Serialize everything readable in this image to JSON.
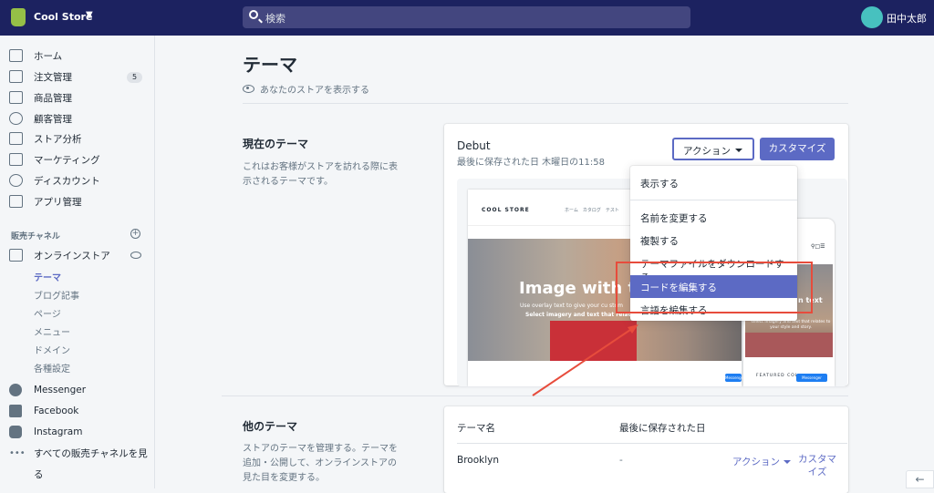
{
  "topbar": {
    "store_name": "Cool Store",
    "search_placeholder": "検索",
    "user_name": "田中太郎"
  },
  "sidebar": {
    "items": [
      {
        "label": "ホーム",
        "icon": "home-icon"
      },
      {
        "label": "注文管理",
        "icon": "orders-icon",
        "badge": "5"
      },
      {
        "label": "商品管理",
        "icon": "tag-icon"
      },
      {
        "label": "顧客管理",
        "icon": "person-icon"
      },
      {
        "label": "ストア分析",
        "icon": "bar-chart-icon"
      },
      {
        "label": "マーケティング",
        "icon": "megaphone-icon"
      },
      {
        "label": "ディスカウント",
        "icon": "discount-icon"
      },
      {
        "label": "アプリ管理",
        "icon": "apps-icon"
      }
    ],
    "channels_header": "販売チャネル",
    "online_store": "オンラインストア",
    "sub_items": [
      "テーマ",
      "ブログ記事",
      "ページ",
      "メニュー",
      "ドメイン",
      "各種設定"
    ],
    "channels": [
      "Messenger",
      "Facebook",
      "Instagram",
      "すべての販売チャネルを見",
      "る"
    ]
  },
  "main": {
    "title": "テーマ",
    "view_store": "あなたのストアを表示する",
    "current_theme_title": "現在のテーマ",
    "current_theme_desc1": "これはお客様がストアを訪れる際に表",
    "current_theme_desc2": "示されるテーマです。",
    "theme_name": "Debut",
    "last_saved": "最後に保存された日 木曜日の11:58",
    "action_button": "アクション",
    "customize_button": "カスタマイズ",
    "other_themes_title": "他のテーマ",
    "other_themes_desc1": "ストアのテーマを管理する。テーマを",
    "other_themes_desc2": "追加・公開して、オンラインストアの",
    "other_themes_desc3": "見た目を変更する。",
    "col_name": "テーマ名",
    "col_saved": "最後に保存された日",
    "row": {
      "name": "Brooklyn",
      "saved": "-",
      "action": "アクション",
      "customize1": "カスタマ",
      "customize2": "イズ"
    }
  },
  "preview": {
    "logo": "COOL STORE",
    "nav": "ホーム　カタログ　テスト",
    "hero_title": "Image with te",
    "hero_sub1": "Use overlay text to give your cu stom",
    "hero_sub2": "Select imagery and text that relat",
    "mobile_title": "n text",
    "mobile_sub": "select imagery and text that relates to your style and story.",
    "featured": "FEATURED COL",
    "messenger": "Messenger"
  },
  "dropdown": {
    "items": [
      "表示する",
      "名前を変更する",
      "複製する",
      "テーマファイルをダウンロードする",
      "コードを編集する",
      "言語を編集する"
    ],
    "highlighted_index": 4
  },
  "colors": {
    "topbar": "#1c2260",
    "accent": "#5c6ac4",
    "annotation": "#e74c3c"
  }
}
